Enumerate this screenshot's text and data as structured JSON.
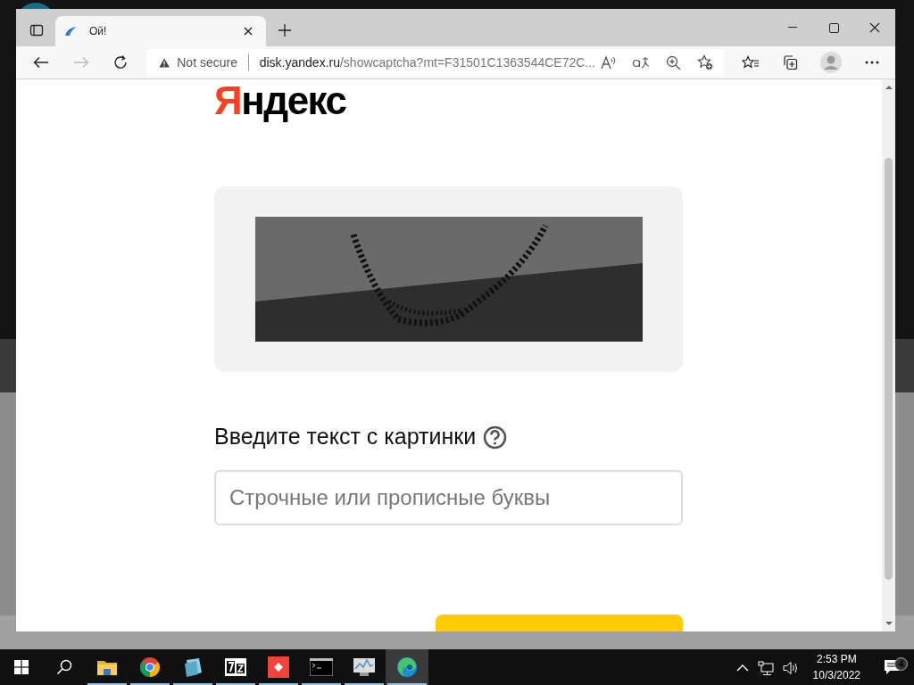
{
  "browser": {
    "tabs": [
      {
        "title": "Ой!",
        "selected": true
      }
    ],
    "address": {
      "security": "Not secure",
      "host": "disk.yandex.ru",
      "path": "/showcaptcha?mt=F31501C1363544CE72C..."
    }
  },
  "page": {
    "logo": {
      "accent": "Я",
      "rest": "ндекс"
    },
    "captcha_label": "Введите текст с картинки",
    "input": {
      "placeholder": "Строчные или прописные буквы"
    }
  },
  "taskbar": {
    "apps": [
      {
        "kind": "folder",
        "running": true,
        "selected": false
      },
      {
        "kind": "chrome",
        "running": true,
        "selected": false
      },
      {
        "kind": "notepad",
        "running": true,
        "selected": false
      },
      {
        "kind": "archive",
        "running": true,
        "selected": false
      },
      {
        "kind": "remote",
        "running": true,
        "selected": false
      },
      {
        "kind": "terminal",
        "running": true,
        "selected": false
      },
      {
        "kind": "monitor",
        "running": true,
        "selected": false
      },
      {
        "kind": "edge",
        "running": true,
        "selected": true
      }
    ],
    "time": "2:53 PM",
    "date": "10/3/2022",
    "notifications": "4"
  }
}
